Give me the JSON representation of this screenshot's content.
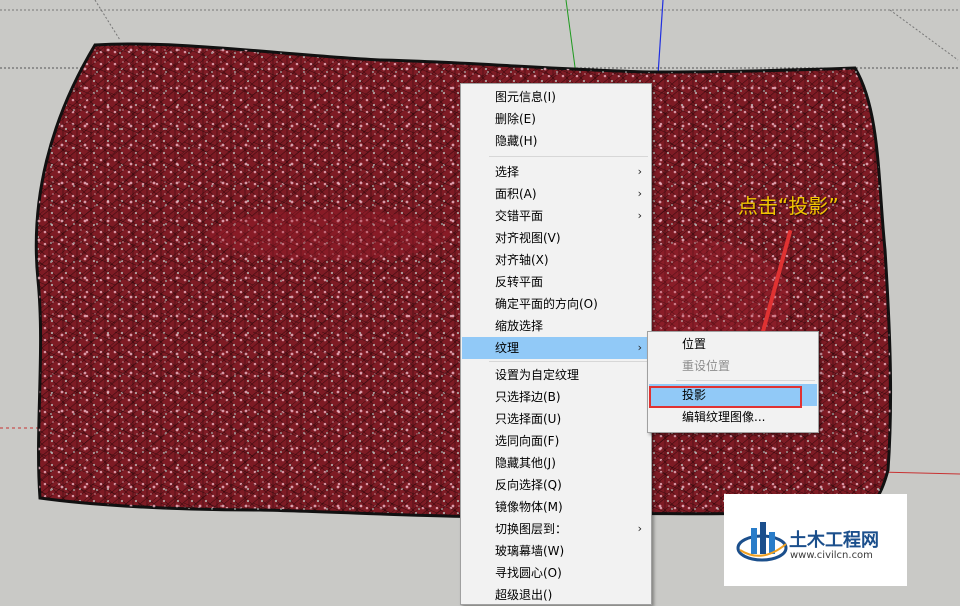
{
  "colors": {
    "viewport_bg": "#c9c9c6",
    "cushion": "#7e1b24",
    "menu_bg": "#f2f2f2",
    "menu_highlight": "#91c9f7",
    "callout_red": "#e03232",
    "annotation_yellow": "#f0c400",
    "logo_blue": "#1b4f8c"
  },
  "context_menu": {
    "items": [
      {
        "label": "图元信息(I)",
        "submenu": false,
        "highlighted": false
      },
      {
        "label": "删除(E)",
        "submenu": false,
        "highlighted": false
      },
      {
        "label": "隐藏(H)",
        "submenu": false,
        "highlighted": false
      },
      {
        "label": "选择",
        "submenu": true,
        "highlighted": false
      },
      {
        "label": "面积(A)",
        "submenu": true,
        "highlighted": false
      },
      {
        "label": "交错平面",
        "submenu": true,
        "highlighted": false
      },
      {
        "label": "对齐视图(V)",
        "submenu": false,
        "highlighted": false
      },
      {
        "label": "对齐轴(X)",
        "submenu": false,
        "highlighted": false
      },
      {
        "label": "反转平面",
        "submenu": false,
        "highlighted": false
      },
      {
        "label": "确定平面的方向(O)",
        "submenu": false,
        "highlighted": false
      },
      {
        "label": "缩放选择",
        "submenu": false,
        "highlighted": false
      },
      {
        "label": "纹理",
        "submenu": true,
        "highlighted": true
      },
      {
        "label": "设置为自定纹理",
        "submenu": false,
        "highlighted": false
      },
      {
        "label": "只选择边(B)",
        "submenu": false,
        "highlighted": false
      },
      {
        "label": "只选择面(U)",
        "submenu": false,
        "highlighted": false
      },
      {
        "label": "选同向面(F)",
        "submenu": false,
        "highlighted": false
      },
      {
        "label": "隐藏其他(J)",
        "submenu": false,
        "highlighted": false
      },
      {
        "label": "反向选择(Q)",
        "submenu": false,
        "highlighted": false
      },
      {
        "label": "镜像物体(M)",
        "submenu": false,
        "highlighted": false
      },
      {
        "label": "切换图层到：",
        "submenu": true,
        "highlighted": false
      },
      {
        "label": "玻璃幕墙(W)",
        "submenu": false,
        "highlighted": false
      },
      {
        "label": "寻找圆心(O)",
        "submenu": false,
        "highlighted": false
      },
      {
        "label": "超级退出()",
        "submenu": false,
        "highlighted": false
      }
    ]
  },
  "texture_submenu": {
    "items": [
      {
        "label": "位置",
        "disabled": false,
        "highlighted": false
      },
      {
        "label": "重设位置",
        "disabled": true,
        "highlighted": false
      },
      {
        "label": "投影",
        "disabled": false,
        "highlighted": true
      },
      {
        "label": "编辑纹理图像...",
        "disabled": false,
        "highlighted": false
      }
    ]
  },
  "annotation": {
    "text": "点击“投影”"
  },
  "watermark": {
    "title": "土木工程网",
    "url": "www.civilcn.com"
  },
  "icons": {
    "submenu_arrow": "chevron-right-icon"
  }
}
